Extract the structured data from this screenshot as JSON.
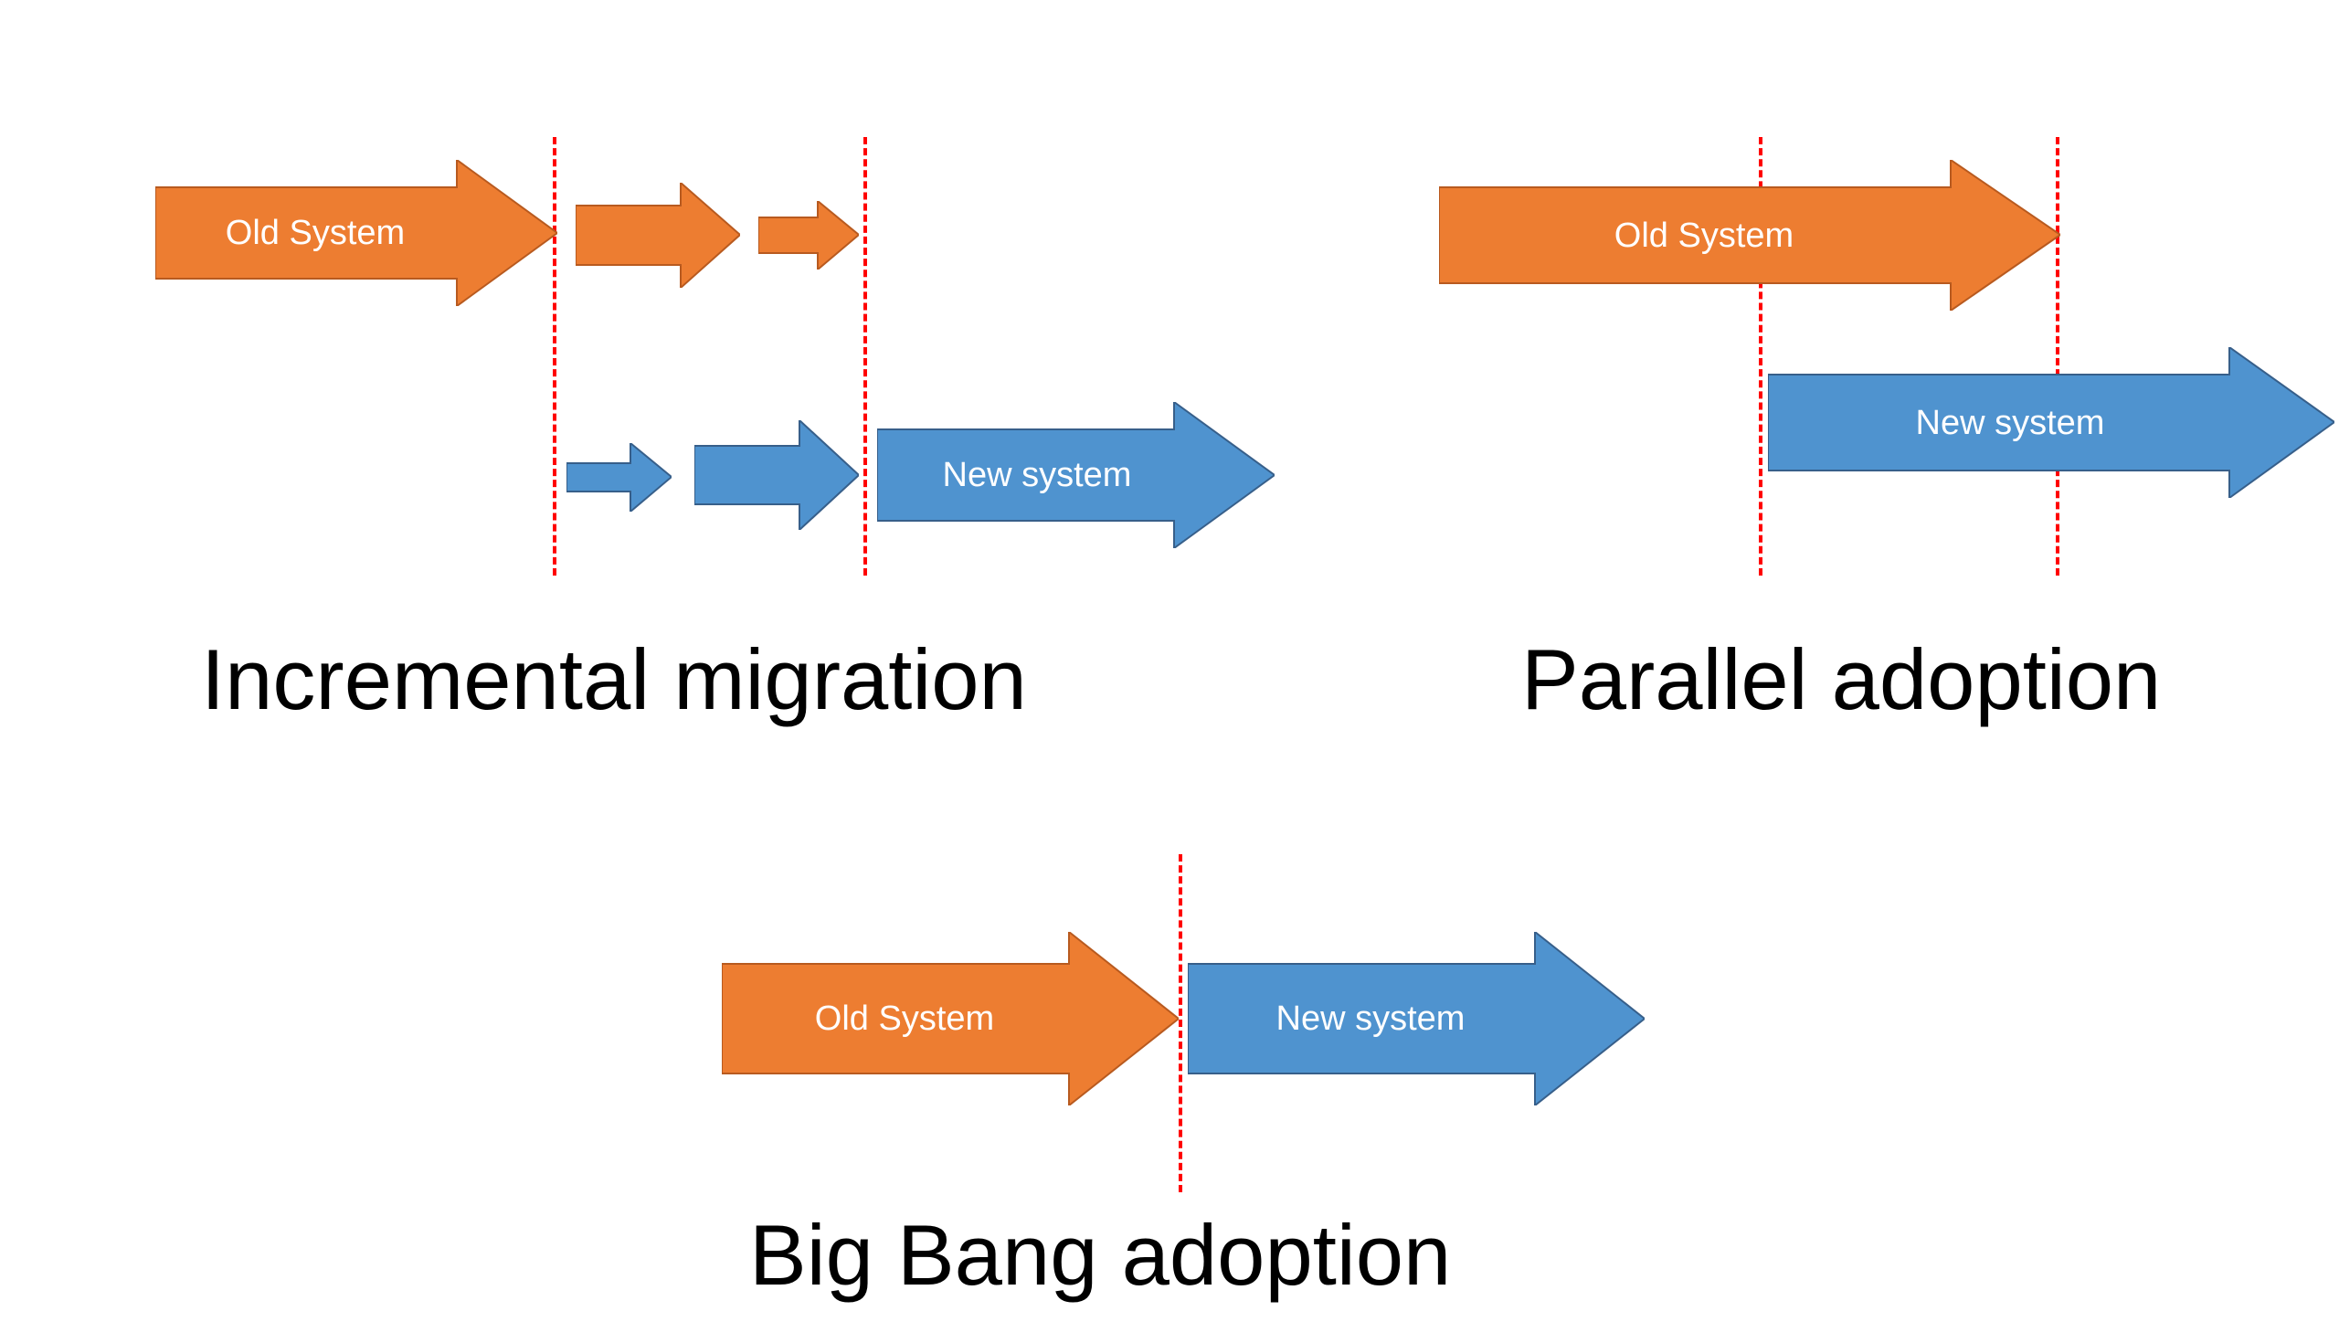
{
  "colors": {
    "old": "#ed7d31",
    "new": "#4f93cf",
    "dash": "#ff0000",
    "stroke": "#375f8a"
  },
  "labels": {
    "old_system": "Old System",
    "new_system": "New system"
  },
  "captions": {
    "incremental": "Incremental migration",
    "parallel": "Parallel adoption",
    "bigbang": "Big Bang adoption"
  }
}
